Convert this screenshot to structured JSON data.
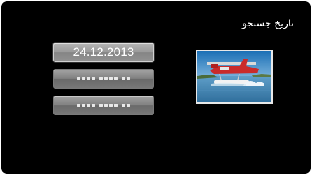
{
  "screen": {
    "title": "تاريخ جستجو"
  },
  "date_list": {
    "items": [
      {
        "label": "24.12.2013",
        "state": "selected"
      },
      {
        "label": "",
        "state": "placeholder"
      },
      {
        "label": "",
        "state": "placeholder"
      }
    ]
  },
  "thumbnail": {
    "icon": "seaplane-photo-thumbnail"
  }
}
